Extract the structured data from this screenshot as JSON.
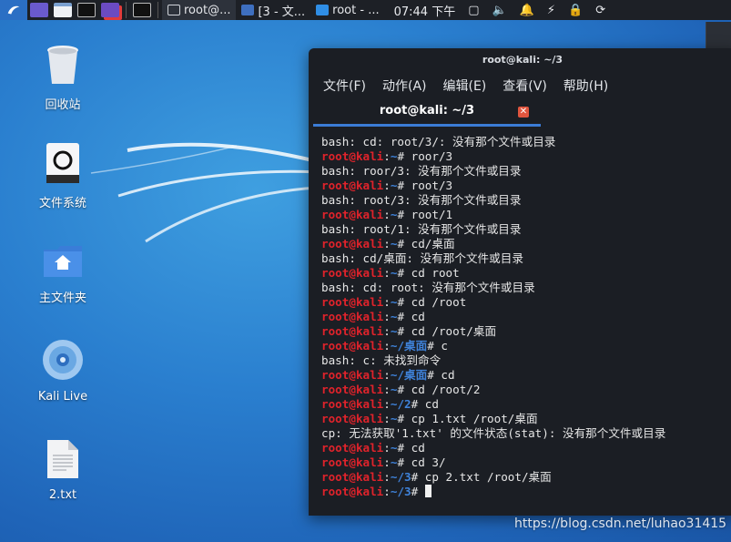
{
  "panel": {
    "tasks": [
      {
        "label": "root@..."
      },
      {
        "label": "[3 - 文..."
      },
      {
        "label": "root - ..."
      }
    ],
    "clock": "07:44 下午"
  },
  "desktop": {
    "icons": [
      {
        "label": "回收站"
      },
      {
        "label": "文件系统"
      },
      {
        "label": "主文件夹"
      },
      {
        "label": "Kali Live"
      },
      {
        "label": "2.txt"
      }
    ]
  },
  "terminal": {
    "window_title": "root@kali: ~/3",
    "menu": [
      "文件(F)",
      "动作(A)",
      "编辑(E)",
      "查看(V)",
      "帮助(H)"
    ],
    "tab_title": "root@kali: ~/3",
    "user": "root",
    "at": "@",
    "host": "kali",
    "lines": [
      {
        "type": "out",
        "text": "bash: cd: root/3/: 没有那个文件或目录"
      },
      {
        "type": "cmd",
        "path": "~",
        "cmd": "roor/3"
      },
      {
        "type": "out",
        "text": "bash: roor/3: 没有那个文件或目录"
      },
      {
        "type": "cmd",
        "path": "~",
        "cmd": "root/3"
      },
      {
        "type": "out",
        "text": "bash: root/3: 没有那个文件或目录"
      },
      {
        "type": "cmd",
        "path": "~",
        "cmd": "root/1"
      },
      {
        "type": "out",
        "text": "bash: root/1: 没有那个文件或目录"
      },
      {
        "type": "cmd",
        "path": "~",
        "cmd": "cd/桌面"
      },
      {
        "type": "out",
        "text": "bash: cd/桌面: 没有那个文件或目录"
      },
      {
        "type": "cmd",
        "path": "~",
        "cmd": "cd root"
      },
      {
        "type": "out",
        "text": "bash: cd: root: 没有那个文件或目录"
      },
      {
        "type": "cmd",
        "path": "~",
        "cmd": "cd /root"
      },
      {
        "type": "cmd",
        "path": "~",
        "cmd": "cd"
      },
      {
        "type": "cmd",
        "path": "~",
        "cmd": "cd /root/桌面"
      },
      {
        "type": "cmd",
        "path": "~/桌面",
        "cmd": "c"
      },
      {
        "type": "out",
        "text": "bash: c: 未找到命令"
      },
      {
        "type": "cmd",
        "path": "~/桌面",
        "cmd": "cd"
      },
      {
        "type": "cmd",
        "path": "~",
        "cmd": "cd /root/2"
      },
      {
        "type": "cmd",
        "path": "~/2",
        "cmd": "cd"
      },
      {
        "type": "cmd",
        "path": "~",
        "cmd": "cp 1.txt /root/桌面"
      },
      {
        "type": "out",
        "text": "cp: 无法获取'1.txt' 的文件状态(stat): 没有那个文件或目录"
      },
      {
        "type": "cmd",
        "path": "~",
        "cmd": "cd"
      },
      {
        "type": "cmd",
        "path": "~",
        "cmd": "cd 3/"
      },
      {
        "type": "cmd",
        "path": "~/3",
        "cmd": "cp 2.txt /root/桌面"
      },
      {
        "type": "prompt",
        "path": "~/3",
        "cmd": ""
      }
    ]
  },
  "watermark": "https://blog.csdn.net/luhao31415",
  "colors": {
    "user": "#e0232b",
    "path": "#3f82d9",
    "accent": "#3b7cd6"
  }
}
